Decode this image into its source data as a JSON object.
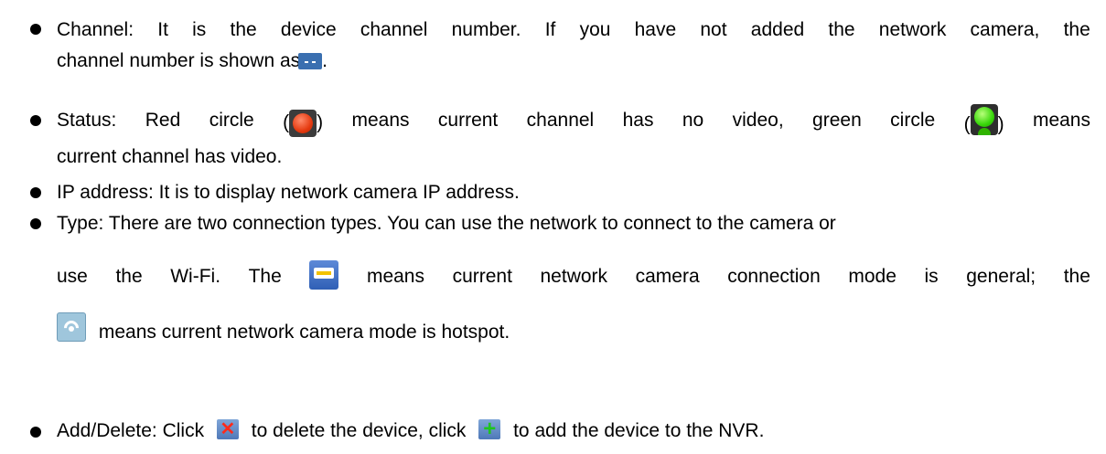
{
  "items": [
    {
      "l1_words": [
        "Channel:",
        "It",
        "is",
        "the",
        "device",
        "channel",
        "number.",
        "If",
        "you",
        "have",
        "not",
        "added",
        "the",
        "network",
        "camera,",
        "the"
      ],
      "l2": "channel number is shown as",
      "l2_end": "."
    },
    {
      "l1_words": [
        "Status:",
        "Red",
        "circle",
        "(",
        ")",
        "means",
        "current",
        "channel",
        "has",
        "no",
        "video,",
        "green",
        "circle",
        "(",
        ")",
        "means"
      ],
      "l2": "current channel has video."
    },
    {
      "text": "IP address: It is to display network camera IP address."
    },
    {
      "l1": "Type: There are two connection types. You can use the network to connect to the camera or",
      "l2_words": [
        "use",
        "the",
        "Wi-Fi.",
        "The",
        "means",
        "current",
        "network",
        "camera",
        "connection",
        "mode",
        "is",
        "general;",
        "the"
      ],
      "l3": "means current network camera mode is hotspot."
    },
    {
      "a": "Add/Delete: Click",
      "b": "to delete the device, click",
      "c": "to add the device to the NVR."
    }
  ],
  "icons": {
    "dash_glyph": "- -",
    "del_glyph": "✕",
    "add_glyph": "+"
  }
}
